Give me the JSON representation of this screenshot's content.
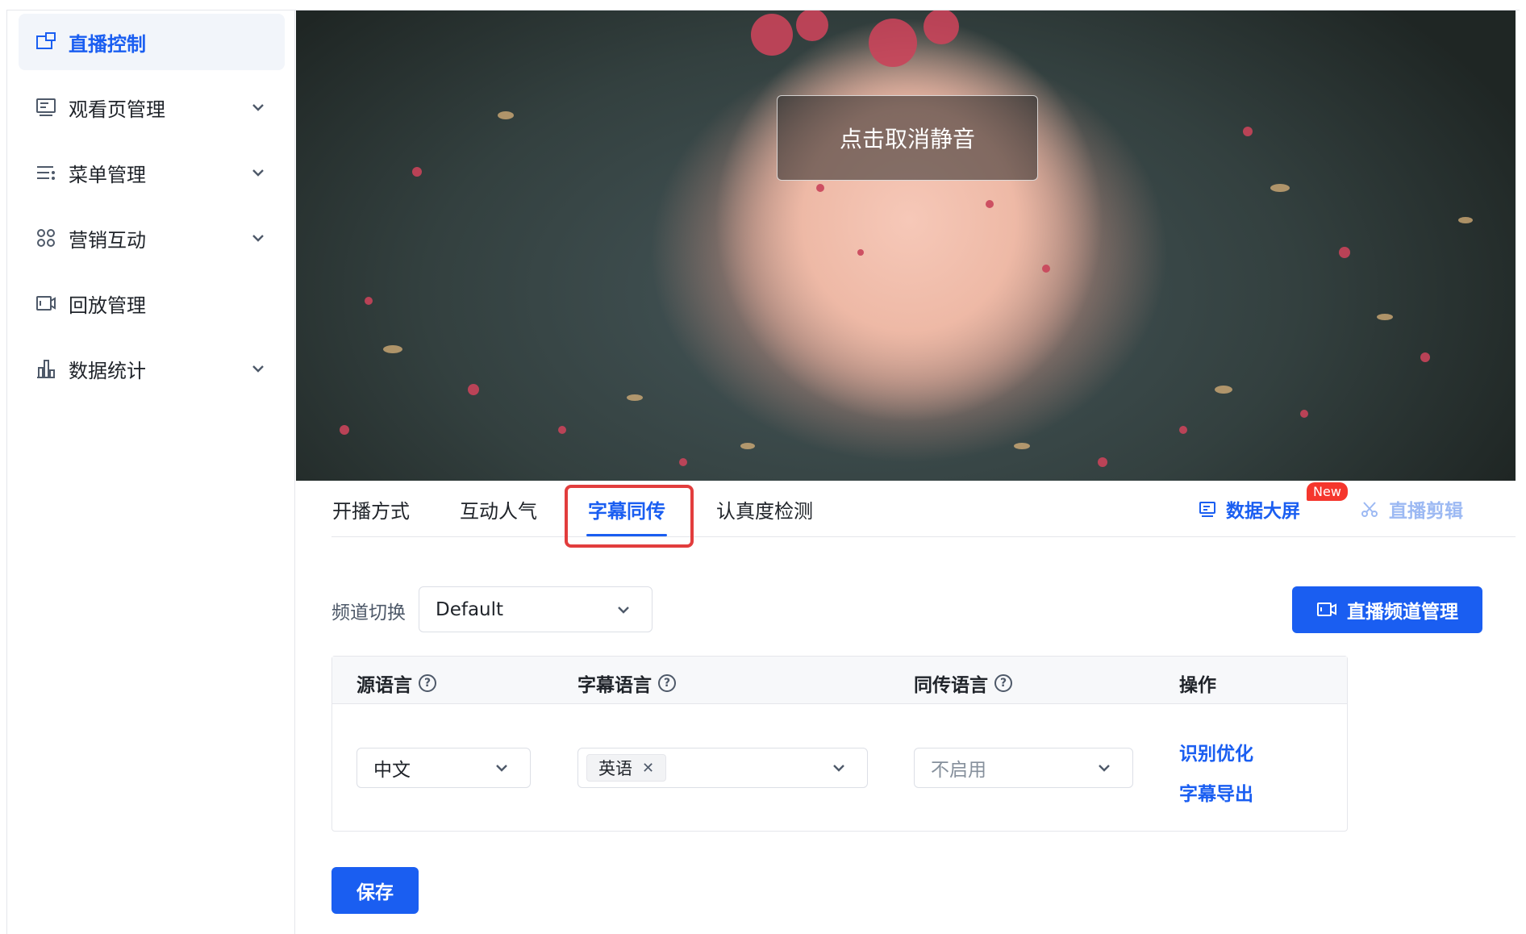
{
  "sidebar": {
    "items": [
      {
        "label": "直播控制",
        "icon": "layout-icon",
        "expandable": false,
        "active": true
      },
      {
        "label": "观看页管理",
        "icon": "monitor-icon",
        "expandable": true
      },
      {
        "label": "菜单管理",
        "icon": "menu-icon",
        "expandable": true
      },
      {
        "label": "营销互动",
        "icon": "apps-icon",
        "expandable": true
      },
      {
        "label": "回放管理",
        "icon": "video-icon",
        "expandable": false
      },
      {
        "label": "数据统计",
        "icon": "bar-chart-icon",
        "expandable": true
      }
    ]
  },
  "video": {
    "mute_label": "点击取消静音"
  },
  "tabs": {
    "items": [
      "开播方式",
      "互动人气",
      "字幕同传",
      "认真度检测"
    ],
    "active_index": 2,
    "data_screen_label": "数据大屏",
    "new_badge": "New",
    "clip_label": "直播剪辑"
  },
  "channel": {
    "label": "频道切换",
    "selected": "Default",
    "manage_button": "直播频道管理"
  },
  "table": {
    "headers": [
      "源语言",
      "字幕语言",
      "同传语言",
      "操作"
    ],
    "row": {
      "source_language": "中文",
      "subtitle_tags": [
        "英语"
      ],
      "interpret_placeholder": "不启用",
      "actions": [
        "识别优化",
        "字幕导出"
      ]
    }
  },
  "save_button": "保存",
  "colors": {
    "primary": "#1a5ef1",
    "highlight_border": "#e23d3d",
    "badge": "#f5362d"
  }
}
